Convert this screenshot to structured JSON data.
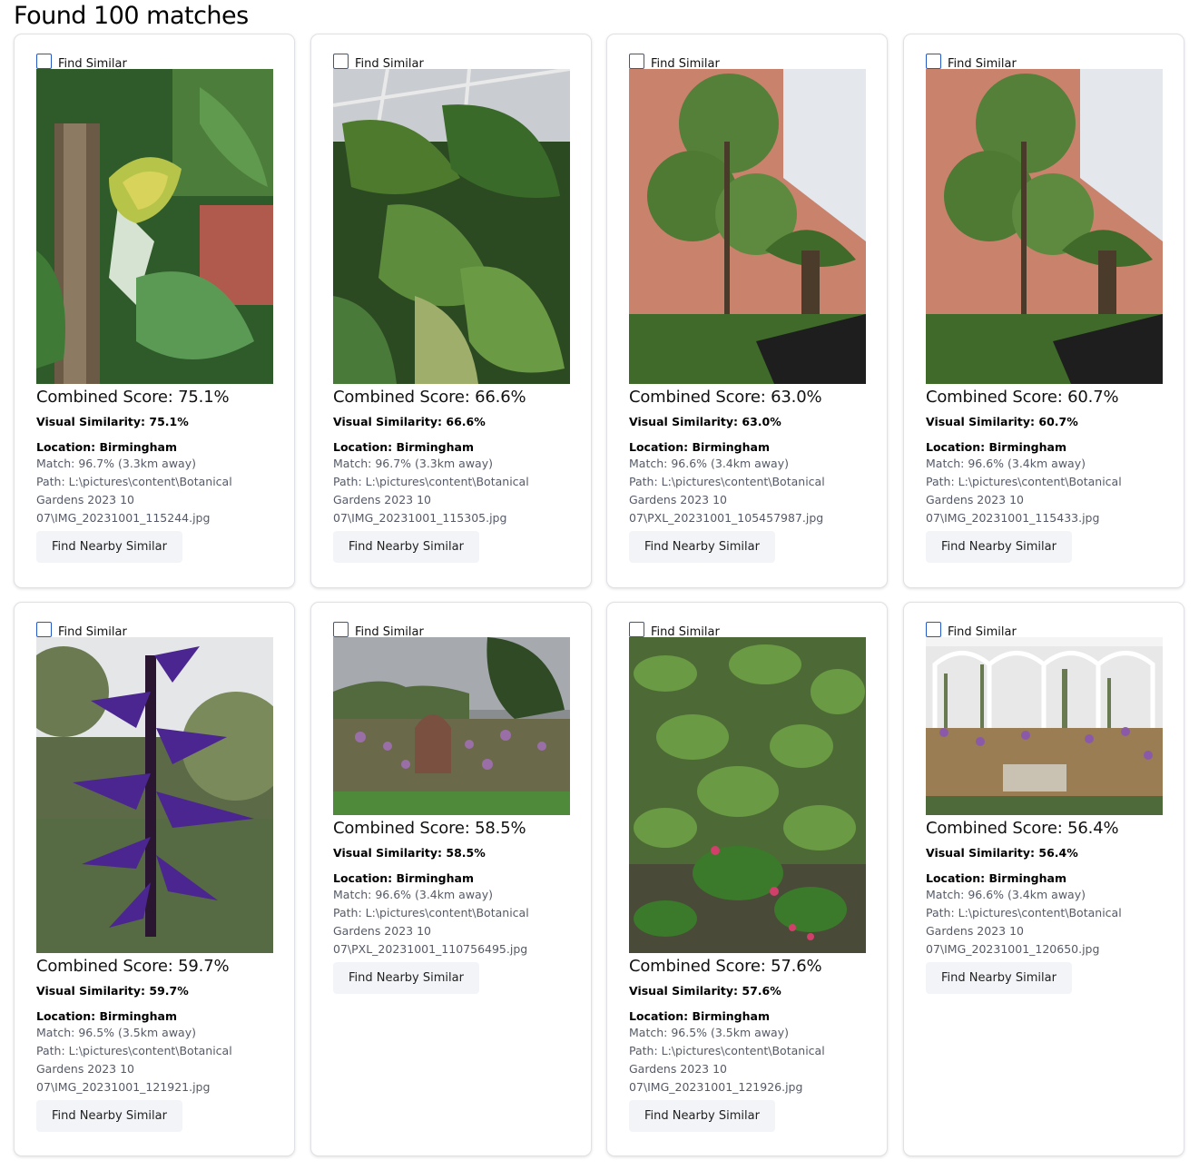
{
  "heading": "Found 100 matches",
  "labels": {
    "find_similar": "Find Similar",
    "find_nearby": "Find Nearby Similar",
    "combined_prefix": "Combined Score:",
    "visual_prefix": "Visual Similarity:",
    "location_prefix": "Location:",
    "match_prefix": "Match:",
    "path_prefix": "Path:"
  },
  "results": [
    {
      "combined": "Combined Score: 75.1%",
      "visual": "Visual Similarity: 75.1%",
      "location": "Location: Birmingham",
      "match": "Match: 96.7% (3.3km away)",
      "path1": "Path: L:\\pictures\\content\\Botanical",
      "path2": "Gardens 2023 10",
      "path3": "07\\IMG_20231001_115244.jpg",
      "checked": false,
      "photo": "banana-plant"
    },
    {
      "combined": "Combined Score: 66.6%",
      "visual": "Visual Similarity: 66.6%",
      "location": "Location: Birmingham",
      "match": "Match: 96.7% (3.3km away)",
      "path1": "Path: L:\\pictures\\content\\Botanical",
      "path2": "Gardens 2023 10",
      "path3": "07\\IMG_20231001_115305.jpg",
      "checked": false,
      "photo": "greenhouse-foliage"
    },
    {
      "combined": "Combined Score: 63.0%",
      "visual": "Visual Similarity: 63.0%",
      "location": "Location: Birmingham",
      "match": "Match: 96.6% (3.4km away)",
      "path1": "Path: L:\\pictures\\content\\Botanical",
      "path2": "Gardens 2023 10",
      "path3": "07\\PXL_20231001_105457987.jpg",
      "checked": false,
      "photo": "greenhouse-tree"
    },
    {
      "combined": "Combined Score: 60.7%",
      "visual": "Visual Similarity: 60.7%",
      "location": "Location: Birmingham",
      "match": "Match: 96.6% (3.4km away)",
      "path1": "Path: L:\\pictures\\content\\Botanical",
      "path2": "Gardens 2023 10",
      "path3": "07\\IMG_20231001_115433.jpg",
      "checked": false,
      "photo": "greenhouse-tree"
    },
    {
      "combined": "Combined Score: 59.7%",
      "visual": "Visual Similarity: 59.7%",
      "location": "Location: Birmingham",
      "match": "Match: 96.5% (3.5km away)",
      "path1": "Path: L:\\pictures\\content\\Botanical",
      "path2": "Gardens 2023 10",
      "path3": "07\\IMG_20231001_121921.jpg",
      "checked": false,
      "photo": "purple-salvia"
    },
    {
      "combined": "Combined Score: 58.5%",
      "visual": "Visual Similarity: 58.5%",
      "location": "Location: Birmingham",
      "match": "Match: 96.6% (3.4km away)",
      "path1": "Path: L:\\pictures\\content\\Botanical",
      "path2": "Gardens 2023 10",
      "path3": "07\\PXL_20231001_110756495.jpg",
      "checked": false,
      "photo": "garden-landscape"
    },
    {
      "combined": "Combined Score: 57.6%",
      "visual": "Visual Similarity: 57.6%",
      "location": "Location: Birmingham",
      "match": "Match: 96.5% (3.5km away)",
      "path1": "Path: L:\\pictures\\content\\Botanical",
      "path2": "Gardens 2023 10",
      "path3": "07\\IMG_20231001_121926.jpg",
      "checked": false,
      "photo": "fuchsia-foliage"
    },
    {
      "combined": "Combined Score: 56.4%",
      "visual": "Visual Similarity: 56.4%",
      "location": "Location: Birmingham",
      "match": "Match: 96.6% (3.4km away)",
      "path1": "Path: L:\\pictures\\content\\Botanical",
      "path2": "Gardens 2023 10",
      "path3": "07\\IMG_20231001_120650.jpg",
      "checked": false,
      "photo": "glasshouse-verbena"
    }
  ]
}
